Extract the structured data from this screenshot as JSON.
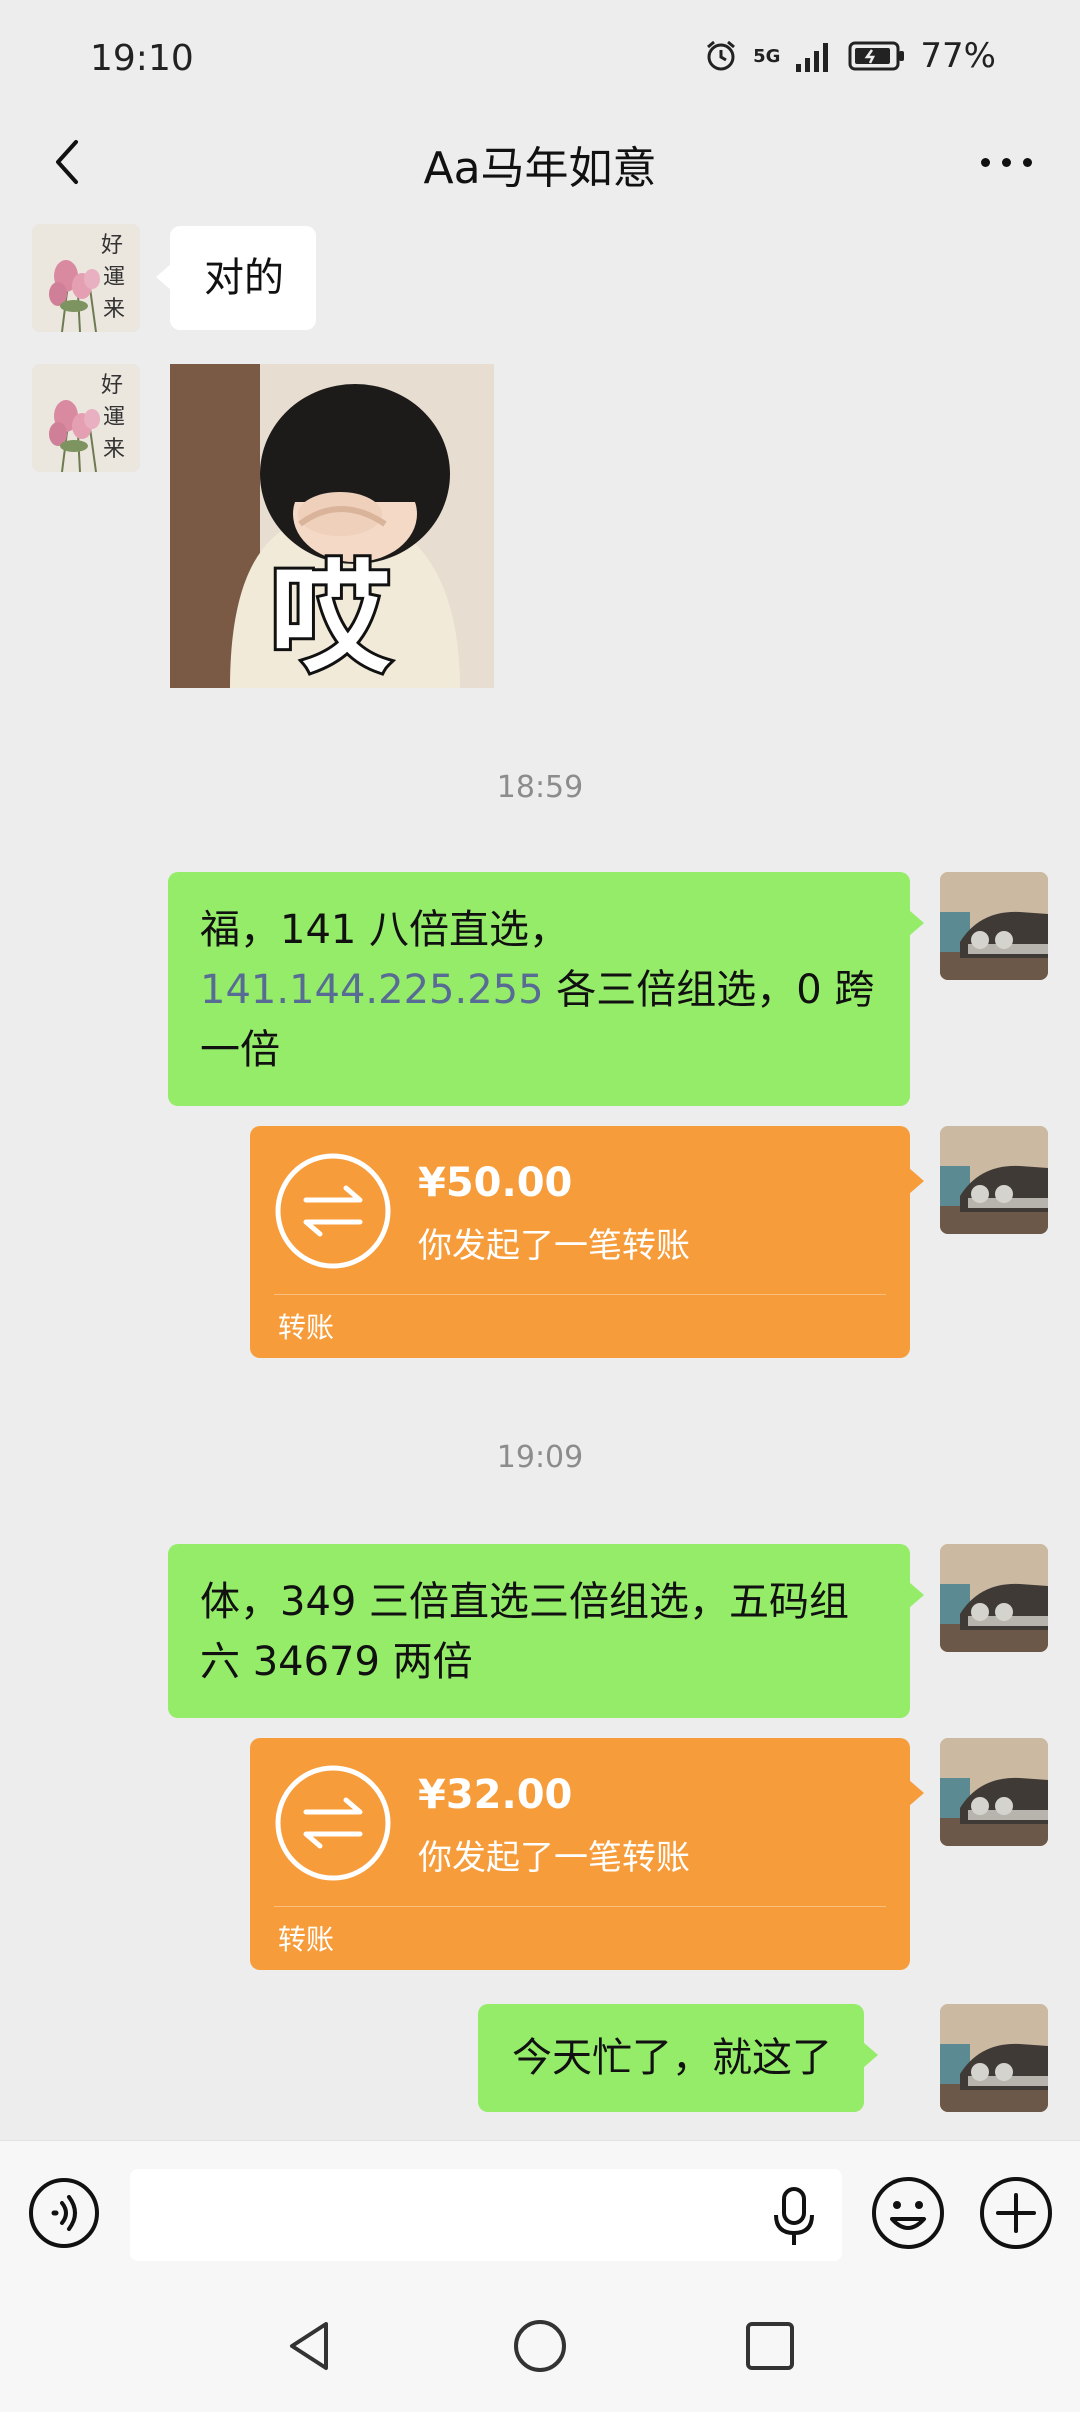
{
  "status_bar": {
    "time": "19:10",
    "network": "5G",
    "battery": "77%"
  },
  "title_bar": {
    "title": "Aa马年如意"
  },
  "messages": {
    "m1_text": "对的",
    "sticker_caption": "哎",
    "time_1": "18:59",
    "m2_text_1": "福，141 八倍直选，",
    "m2_link": "141.144.225.255",
    "m2_text_2": " 各三倍组选，0 跨一倍",
    "transfer_1": {
      "amount": "¥50.00",
      "desc": "你发起了一笔转账",
      "label": "转账"
    },
    "time_2": "19:09",
    "m3_text": "体，349 三倍直选三倍组选，五码组六 34679 两倍",
    "transfer_2": {
      "amount": "¥32.00",
      "desc": "你发起了一笔转账",
      "label": "转账"
    },
    "m4_text": "今天忙了，就这了"
  },
  "avatar_contact_text": [
    "好",
    "運",
    "来"
  ],
  "input_bar": {
    "value": "",
    "placeholder": ""
  },
  "icons": {
    "back": "chevron-left-icon",
    "more": "more-dots-icon",
    "voice": "voice-icon",
    "mic": "microphone-icon",
    "emoji": "emoji-icon",
    "plus": "plus-icon",
    "transfer": "transfer-arrows-icon"
  },
  "colors": {
    "background": "#ededed",
    "bubble_self": "#95ec69",
    "bubble_other": "#ffffff",
    "transfer": "#f79c3a",
    "link": "#576b95"
  }
}
